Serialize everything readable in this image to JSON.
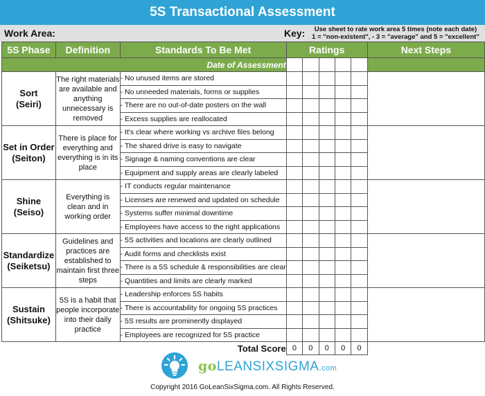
{
  "title": "5S Transactional Assessment",
  "work_area_label": "Work Area:",
  "key_label": "Key:",
  "key_note_line1": "Use sheet to rate work area 5 times (note each date)",
  "key_note_line2": "1 = \"non-existent\", - 3 = \"average\" and 5 = \"excellent\"",
  "headers": {
    "phase": "5S Phase",
    "definition": "Definition",
    "standards": "Standards To Be Met",
    "ratings": "Ratings",
    "next_steps": "Next Steps"
  },
  "date_row_label": "Date of Assessment",
  "phases": [
    {
      "name": "Sort",
      "japanese": "(Seiri)",
      "definition": "The right materials are available and anything unnecessary is removed",
      "standards": [
        "- No unused items are stored",
        "- No unneeded materials, forms or supplies",
        "- There are no out-of-date posters on the wall",
        "- Excess supplies are reallocated"
      ]
    },
    {
      "name": "Set in Order",
      "japanese": "(Seiton)",
      "definition": "There is place for everything and everything is in its place",
      "standards": [
        "- It's clear where working vs archive files belong",
        "- The shared drive is easy to navigate",
        "- Signage & naming conventions are clear",
        "- Equipment and supply areas are clearly labeled"
      ]
    },
    {
      "name": "Shine",
      "japanese": "(Seiso)",
      "definition": "Everything is clean and in working order",
      "standards": [
        "- IT conducts regular maintenance",
        "- Licenses are renewed and updated on schedule",
        "- Systems suffer minimal downtime",
        "- Employees have access to the right applications"
      ]
    },
    {
      "name": "Standardize",
      "japanese": "(Seiketsu)",
      "definition": "Guidelines and practices are established to maintain first three steps",
      "standards": [
        "- 5S activities and locations are clearly outlined",
        "- Audit forms and checklists exist",
        "- There is a 5S schedule & responsibilities are clear",
        "- Quantities and limits are clearly marked"
      ]
    },
    {
      "name": "Sustain",
      "japanese": "(Shitsuke)",
      "definition": "5S is a habit that people incorporate into their daily practice",
      "standards": [
        "- Leadership enforces 5S habits",
        "- There is accountability for ongoing 5S practices",
        "- 5S results are prominently displayed",
        "- Employees are recognized for 5S practice"
      ]
    }
  ],
  "total_score_label": "Total Score",
  "total_scores": [
    "0",
    "0",
    "0",
    "0",
    "0"
  ],
  "logo": {
    "go": "go",
    "brand": "LEANSIXSIGMA",
    "domain": ".com"
  },
  "copyright": "Copyright 2016 GoLeanSixSigma.com. All Rights Reserved."
}
